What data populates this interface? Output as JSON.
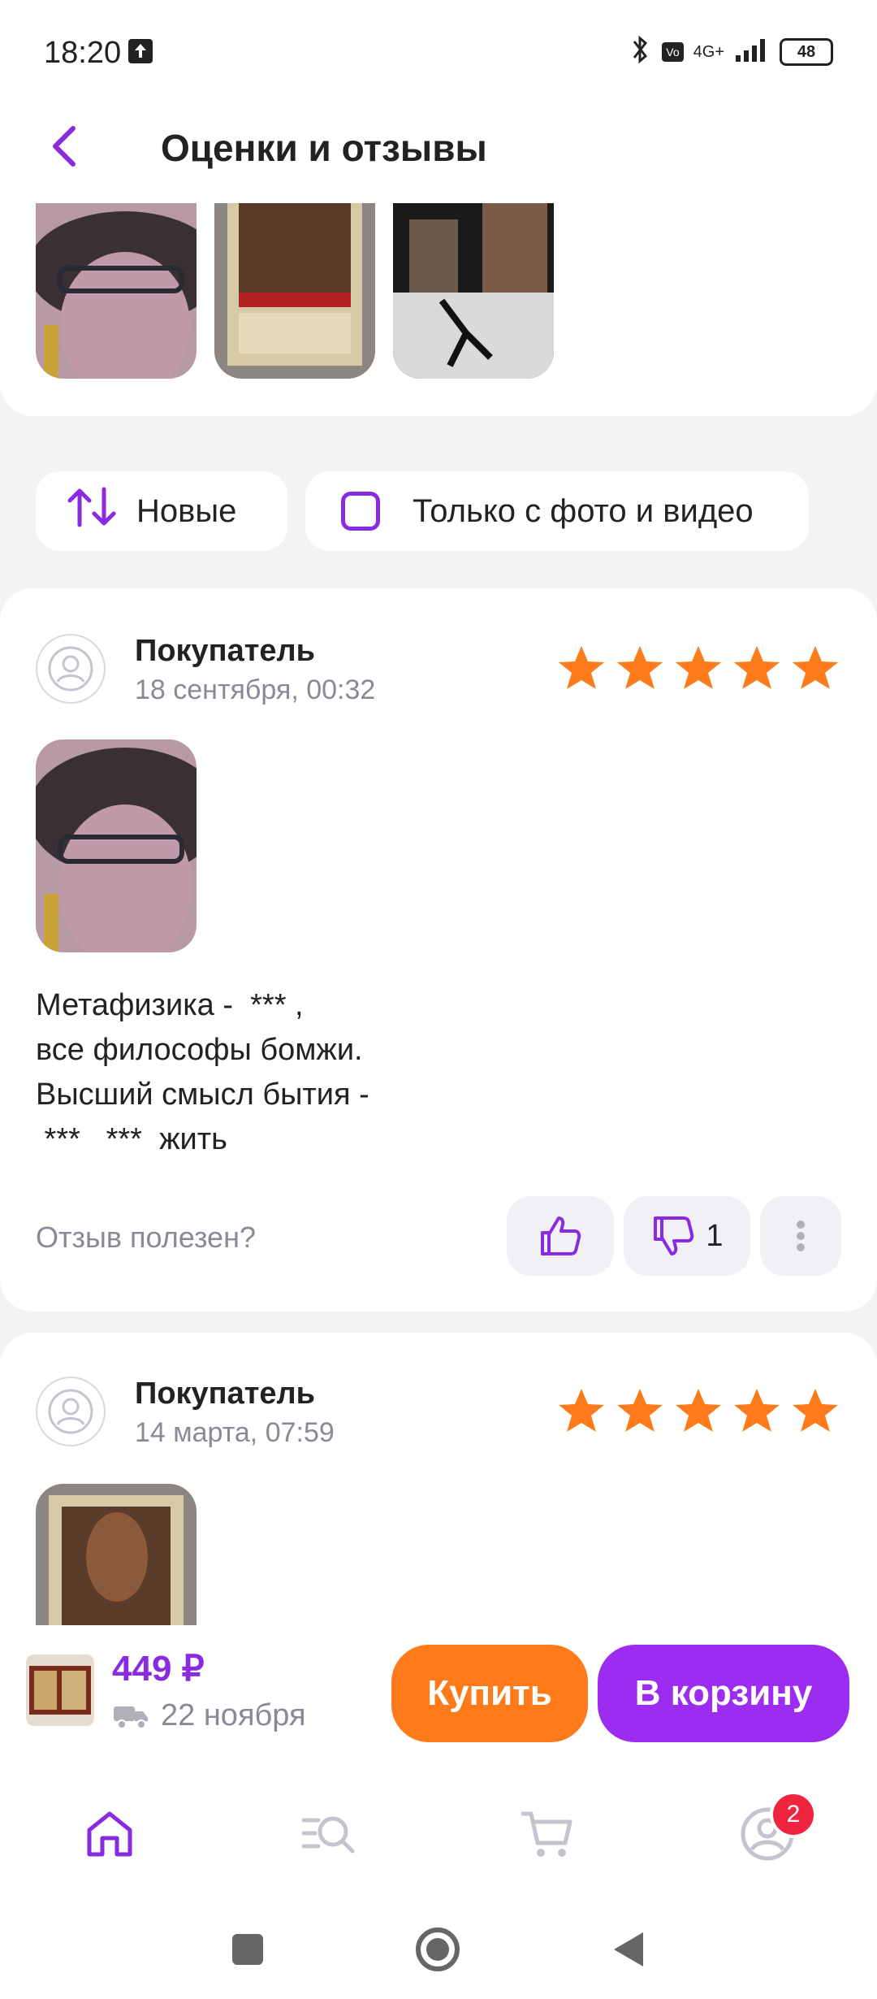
{
  "status_bar": {
    "time": "18:20",
    "network": "4G+",
    "battery": "48"
  },
  "header": {
    "title": "Оценки и отзывы"
  },
  "filters": {
    "sort_label": "Новые",
    "photo_only_label": "Только с фото и видео"
  },
  "reviews": [
    {
      "author": "Покупатель",
      "date": "18 сентября, 00:32",
      "rating": 5,
      "text_lines": [
        "Метафизика -  *** ,",
        "все философы бомжи.",
        "Высший смысл бытия -",
        " ***   ***  жить"
      ],
      "helpful_label": "Отзыв полезен?",
      "dislikes": "1"
    },
    {
      "author": "Покупатель",
      "date": "14 марта, 07:59",
      "rating": 5
    }
  ],
  "purchase": {
    "price": "449 ₽",
    "delivery": "22 ноября",
    "buy_label": "Купить",
    "cart_label": "В корзину"
  },
  "bottom_nav": {
    "profile_badge": "2"
  },
  "colors": {
    "accent": "#8a2be2",
    "star": "#ff7a1a",
    "buy": "#ff7a1a",
    "cart": "#9b2cf0",
    "badge": "#f0243f"
  }
}
